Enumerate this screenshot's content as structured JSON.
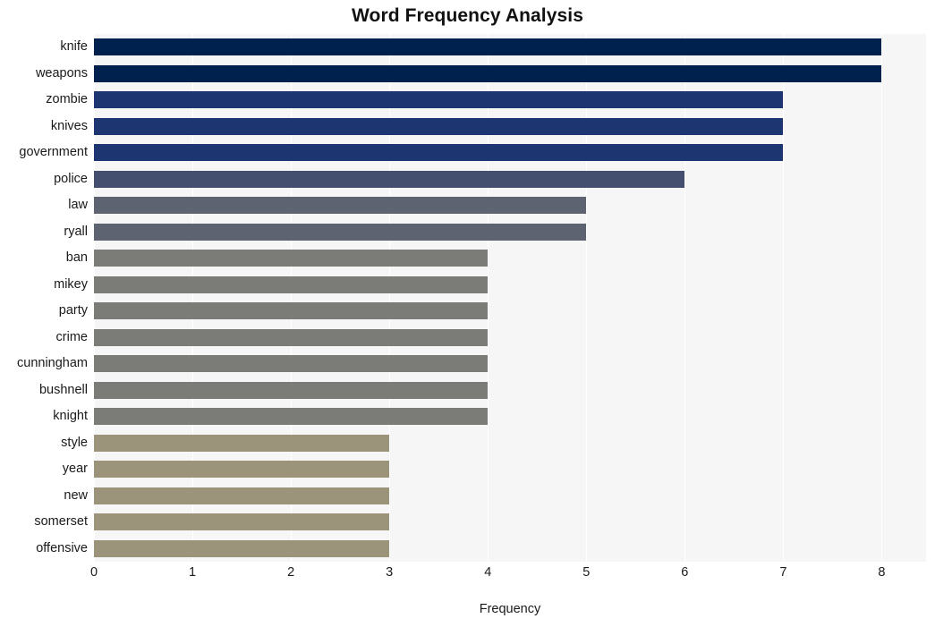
{
  "chart_data": {
    "type": "bar",
    "orientation": "horizontal",
    "title": "Word Frequency Analysis",
    "xlabel": "Frequency",
    "ylabel": "",
    "xlim": [
      0,
      8.45
    ],
    "ylim": [
      0,
      20
    ],
    "grid": "vertical-white-on-light-gray",
    "legend": "none",
    "xticks": [
      "0",
      "1",
      "2",
      "3",
      "4",
      "5",
      "6",
      "7",
      "8"
    ],
    "xtick_values": [
      0,
      1,
      2,
      3,
      4,
      5,
      6,
      7,
      8
    ],
    "categories": [
      "knife",
      "weapons",
      "zombie",
      "knives",
      "government",
      "police",
      "law",
      "ryall",
      "ban",
      "mikey",
      "party",
      "crime",
      "cunningham",
      "bushnell",
      "knight",
      "style",
      "year",
      "new",
      "somerset",
      "offensive"
    ],
    "values": [
      8,
      8,
      7,
      7,
      7,
      6,
      5,
      5,
      4,
      4,
      4,
      4,
      4,
      4,
      4,
      3,
      3,
      3,
      3,
      3
    ],
    "bar_colors": [
      "#00214d",
      "#00214d",
      "#1d3671",
      "#1d3671",
      "#1d3671",
      "#444f70",
      "#5e6372",
      "#5e6372",
      "#7b7b78",
      "#7b7b78",
      "#7b7b78",
      "#7b7b78",
      "#7b7b78",
      "#7b7b78",
      "#7b7b78",
      "#9c947a",
      "#9c947a",
      "#9c947a",
      "#9c947a",
      "#9c947a"
    ],
    "plot_background": "#f6f6f6",
    "figure_background": "#ffffff",
    "gridline_color": "#ffffff"
  }
}
